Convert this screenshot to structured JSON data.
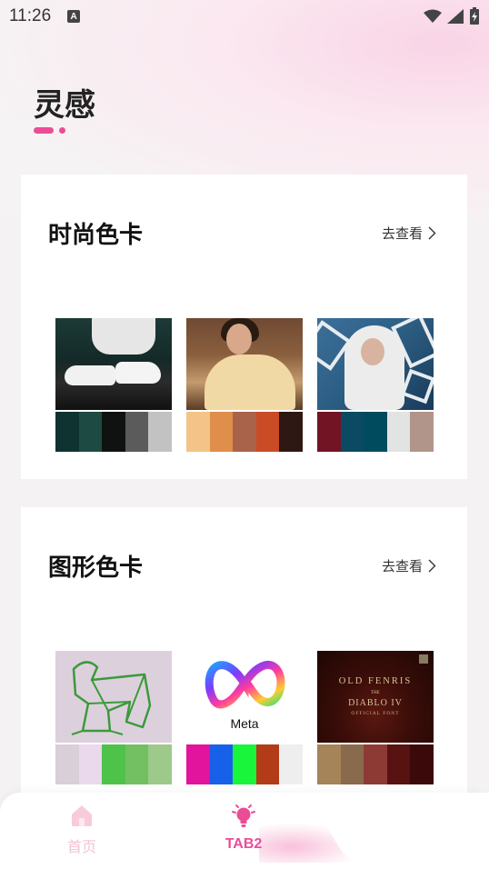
{
  "status_bar": {
    "time": "11:26",
    "notification_icon": "A"
  },
  "header": {
    "title": "灵感"
  },
  "sections": [
    {
      "title": "时尚色卡",
      "link_label": "去查看",
      "items": [
        {
          "image": "sneakers-photo",
          "swatches": [
            "#0f3330",
            "#1d4a43",
            "#101211",
            "#5b5b5b",
            "#c2c2c2"
          ]
        },
        {
          "image": "woman-robe-photo",
          "swatches": [
            "#f3c388",
            "#df8e4b",
            "#a9634a",
            "#c94c26",
            "#2d1814"
          ]
        },
        {
          "image": "white-hood-photo",
          "swatches": [
            "#731424",
            "#0b4a62",
            "#004c5e",
            "#e2e3e3",
            "#b1958a"
          ]
        }
      ]
    },
    {
      "title": "图形色卡",
      "link_label": "去查看",
      "items": [
        {
          "image": "line-figure-illustration",
          "swatches": [
            "#d8cfd8",
            "#ead8ec",
            "#4fc24a",
            "#72c062",
            "#9dc98a"
          ]
        },
        {
          "image": "meta-logo",
          "logo_text": "Meta",
          "swatches": [
            "#e2139c",
            "#1761ea",
            "#19f53a",
            "#b33b17",
            "#eeeeee"
          ]
        },
        {
          "image": "diablo-font-poster",
          "text_lines": [
            "OLD FENRIS",
            "THE",
            "DIABLO IV",
            "OFFICIAL FONT"
          ],
          "swatches": [
            "#a5845a",
            "#8a6a4c",
            "#8e3a34",
            "#581212",
            "#3b0909"
          ]
        }
      ]
    }
  ],
  "tab_bar": {
    "tabs": [
      {
        "label": "首页",
        "icon": "home-icon",
        "active": false
      },
      {
        "label": "TAB2",
        "icon": "lightbulb-icon",
        "active": true
      }
    ],
    "active_color": "#ec4c97",
    "inactive_color": "#f3c3d6"
  },
  "accent_color": "#ec4c97"
}
